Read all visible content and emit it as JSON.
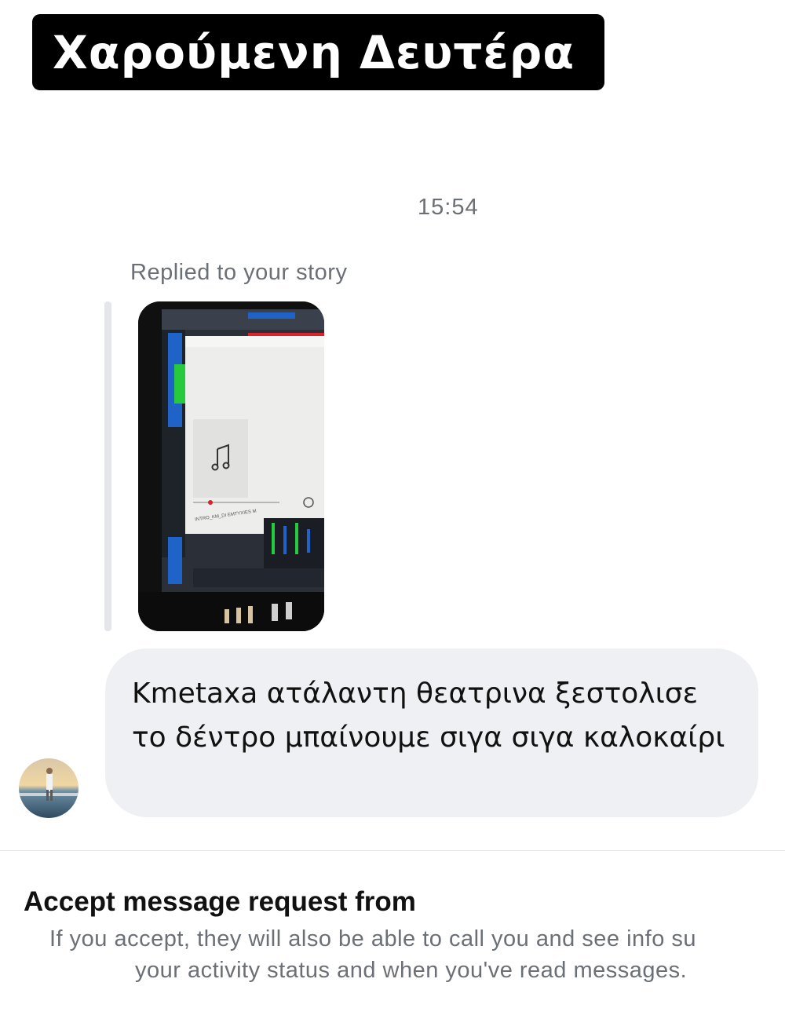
{
  "caption": {
    "text": "Χαρούμενη Δευτέρα"
  },
  "conversation": {
    "timestamp": "15:54",
    "reply_label": "Replied to your story",
    "story_preview": {
      "icon": "music-note-icon",
      "filename": "INTRO_KM_DI EMTYXIES M"
    },
    "message": {
      "text": "Kmetaxa ατάλαντη θεατρινα ξεστολισε το δέντρο μπαίνουμε σιγα σιγα καλοκαίρι"
    }
  },
  "request_panel": {
    "title": "Accept message request from",
    "body_line_1": "If you accept, they will also be able to call you and see info su",
    "body_line_2": "your activity status and when you've read messages."
  },
  "colors": {
    "caption_bg": "#000000",
    "bubble_bg": "#eff0f3",
    "secondary_text": "#6b6f76",
    "daw_blue": "#1f63c8",
    "daw_green": "#27c93f",
    "daw_red": "#d9232a"
  }
}
